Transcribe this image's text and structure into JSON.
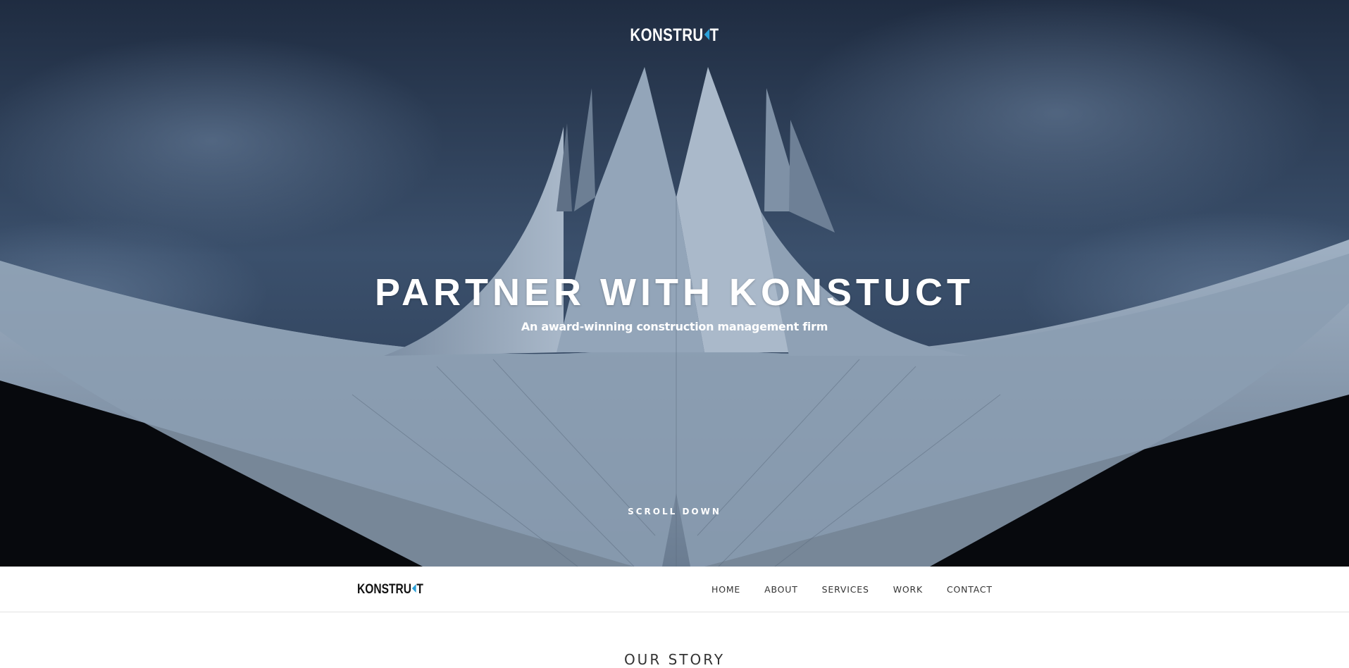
{
  "brand": {
    "logo_before": "KONSTRU",
    "logo_after": "T",
    "accent_color": "#2aa0d8"
  },
  "hero": {
    "title": "PARTNER WITH KONSTUCT",
    "subtitle": "An award-winning construction management firm",
    "scroll_label": "SCROLL DOWN"
  },
  "nav": {
    "items": [
      {
        "label": "HOME"
      },
      {
        "label": "ABOUT"
      },
      {
        "label": "SERVICES"
      },
      {
        "label": "WORK"
      },
      {
        "label": "CONTACT"
      }
    ]
  },
  "section": {
    "title": "OUR STORY"
  }
}
